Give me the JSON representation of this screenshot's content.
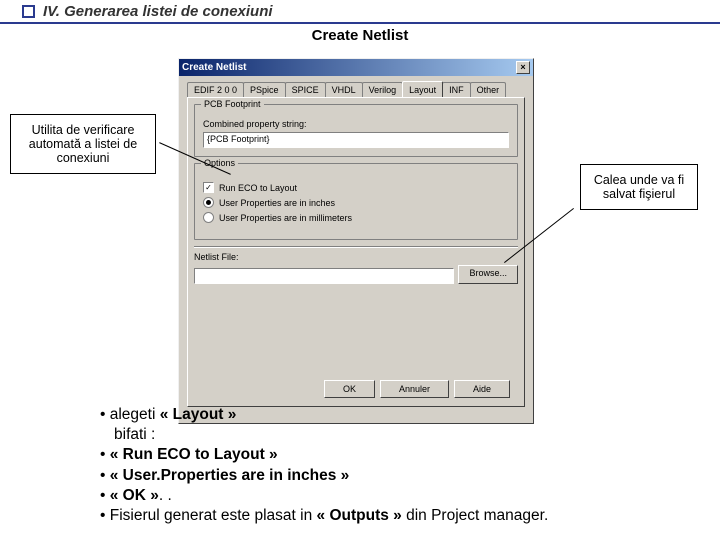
{
  "header": {
    "title": "IV. Generarea listei de conexiuni"
  },
  "subtitle": "Create Netlist",
  "dialog": {
    "title": "Create Netlist",
    "tabs": [
      "EDIF 2 0 0",
      "PSpice",
      "SPICE",
      "VHDL",
      "Verilog",
      "Layout",
      "INF",
      "Other"
    ],
    "group_footprint": {
      "legend": "PCB Footprint",
      "prop_label": "Combined property string:",
      "prop_value": "{PCB Footprint}"
    },
    "group_options": {
      "legend": "Options",
      "run_eco_label": "Run ECO to Layout",
      "radio_inches": "User Properties are in inches",
      "radio_mm": "User Properties are in millimeters"
    },
    "netlist_label": "Netlist File:",
    "browse": "Browse...",
    "buttons": {
      "ok": "OK",
      "cancel": "Annuler",
      "help": "Aide"
    }
  },
  "callout_left": "Utilita de verificare automată a listei de conexiuni",
  "callout_right": "Calea unde va fi salvat fişierul",
  "instructions": {
    "l1a": "• alegeti ",
    "l1b": "« Layout »",
    "l2": "bifati :",
    "l3a": "• ",
    "l3b": "« Run ECO to Layout »",
    "l4a": "• ",
    "l4b": "« User.Properties are in inches »",
    "l5a": "• ",
    "l5b": "« OK »",
    "l5c": ". .",
    "l6a": "• Fisierul generat este plasat in ",
    "l6b": "« Outputs »",
    "l6c": " din Project manager."
  }
}
